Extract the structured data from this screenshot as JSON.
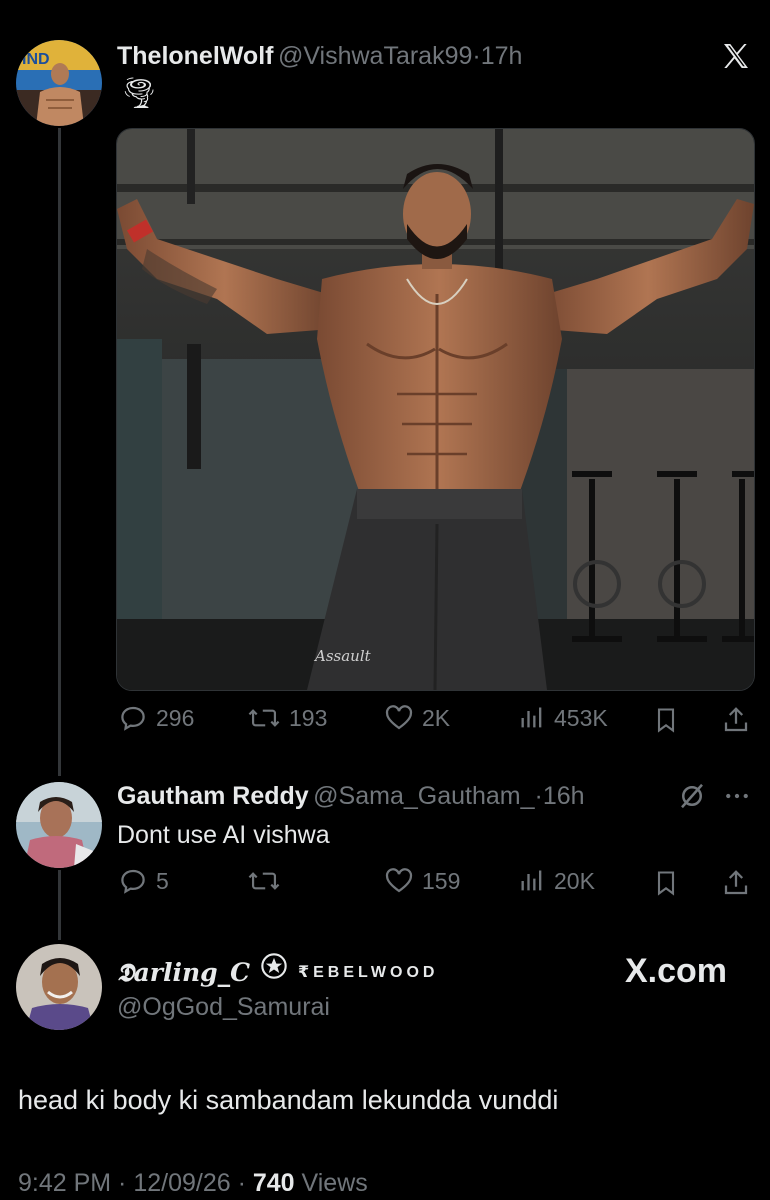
{
  "post": {
    "display_name": "ThelonelWolf",
    "handle": "@VishwaTarak99",
    "sep": "·",
    "time": "17h",
    "emoji": "🌪",
    "image_caption": "Assault",
    "actions": {
      "replies": "296",
      "reposts": "193",
      "likes": "2K",
      "views": "453K"
    }
  },
  "reply": {
    "display_name": "Gautham Reddy",
    "handle": "@Sama_Gautham_",
    "sep": "·",
    "time": "16h",
    "text": "Dont use AI vishwa",
    "actions": {
      "replies": "5",
      "reposts": "",
      "likes": "159",
      "views": "20K"
    }
  },
  "quote": {
    "display_name": "𝕯arling_C",
    "badge_text": "₹EBELWOOD",
    "handle": "@OgGod_Samurai",
    "brand": "X.com",
    "text": "head ki body ki sambandam lekundda vunddi",
    "timestamp": "9:42 PM · 12/09/26 · ",
    "views_count": "740",
    "views_label": " Views"
  },
  "colors": {
    "background": "#000000",
    "text": "#e7e9ea",
    "muted": "#71767b",
    "thread_line": "#333639"
  },
  "icons": [
    "x-logo-icon",
    "reply-icon",
    "repost-icon",
    "like-icon",
    "views-icon",
    "bookmark-icon",
    "share-icon",
    "grok-icon",
    "more-icon",
    "badge-icon"
  ]
}
